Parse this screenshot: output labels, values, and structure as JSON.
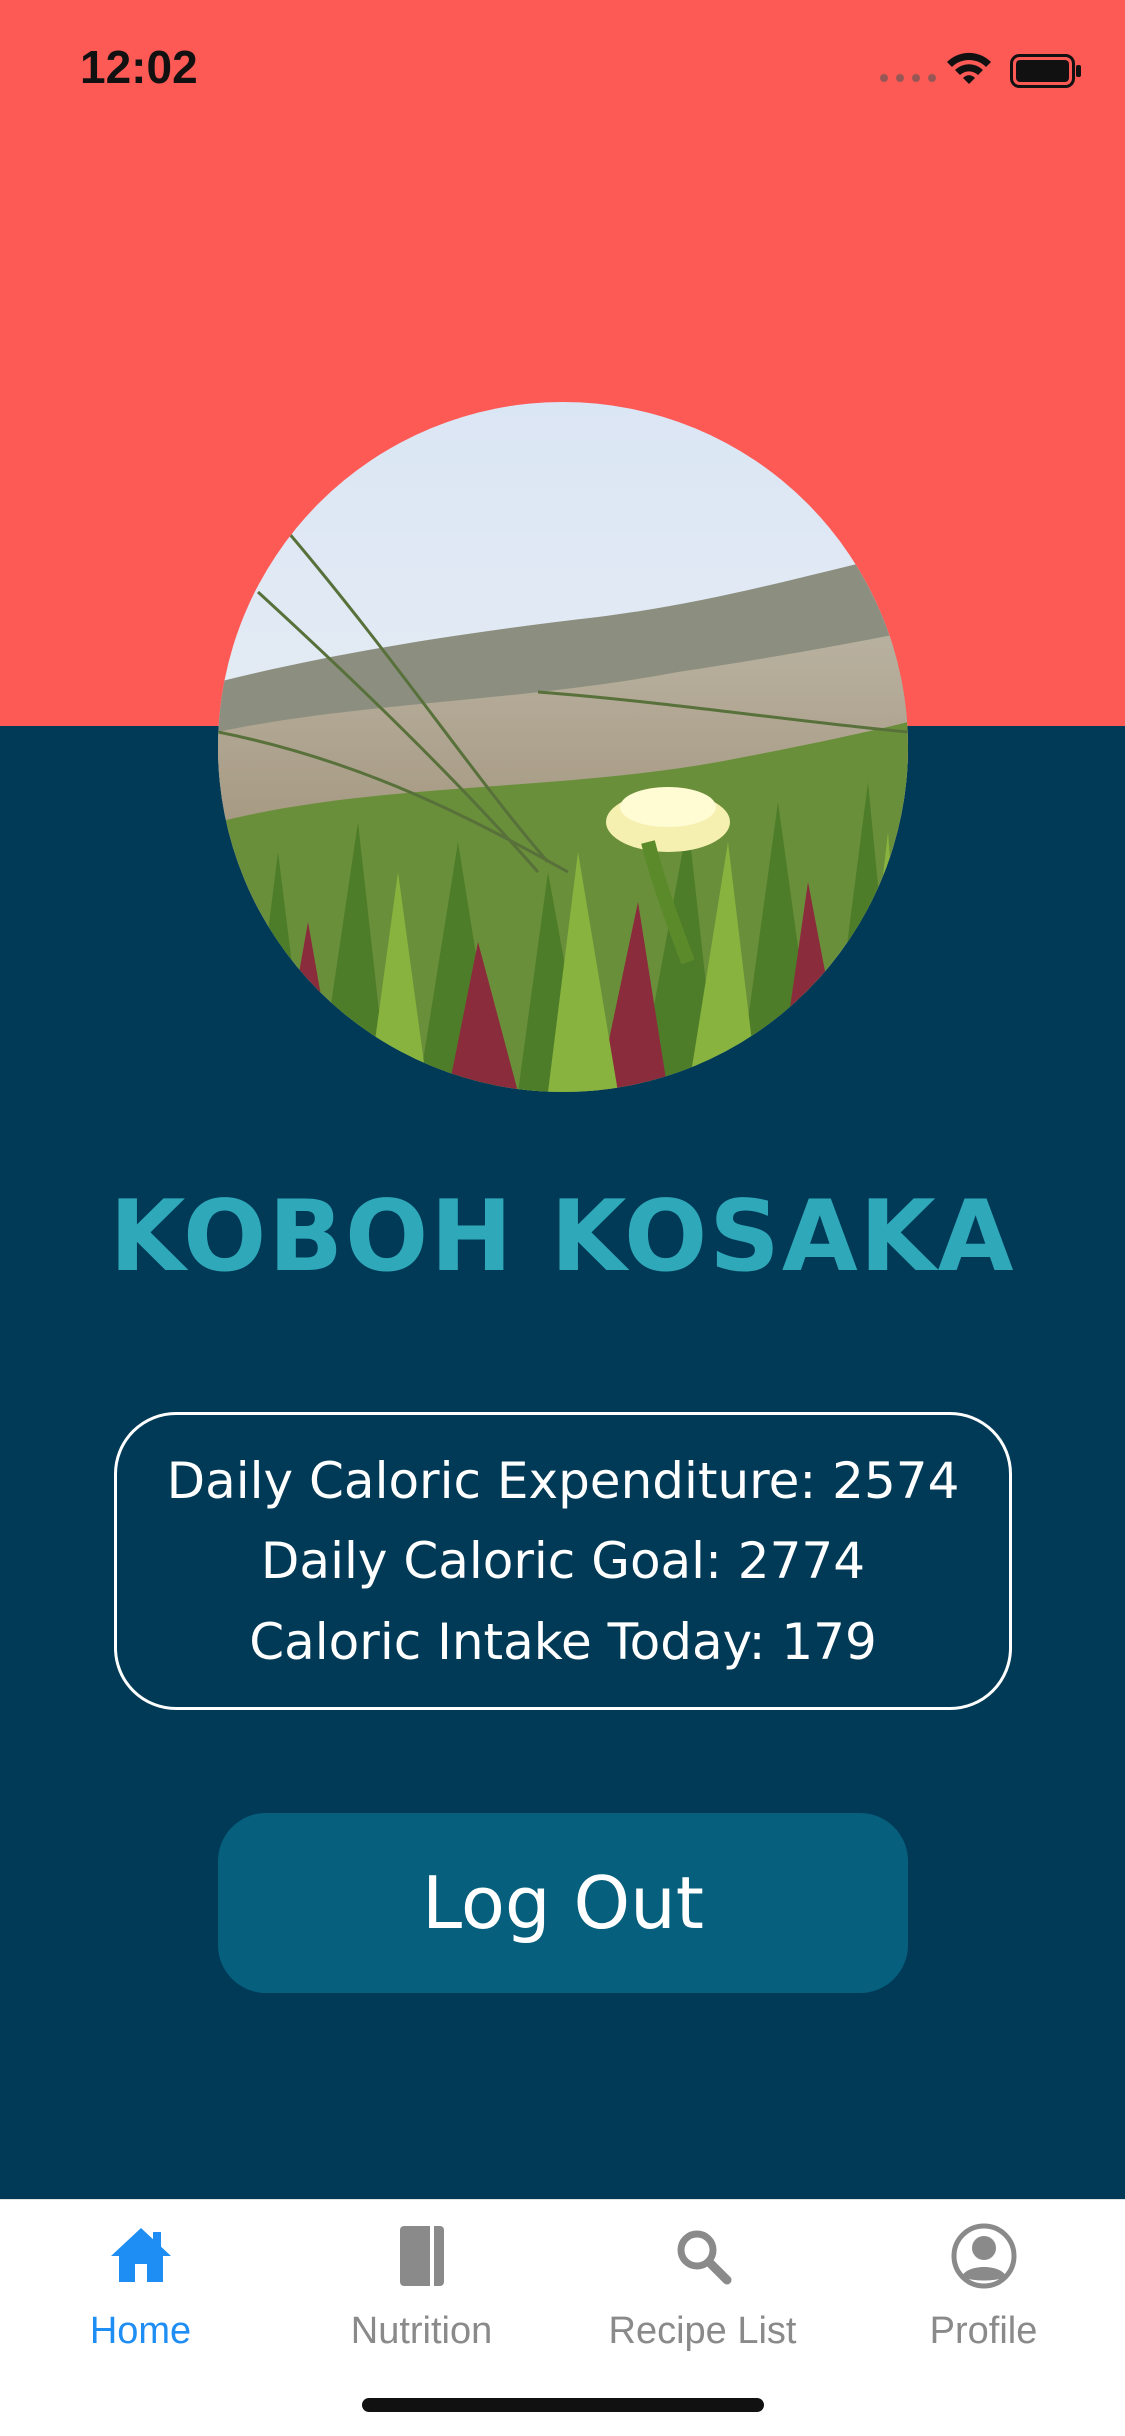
{
  "status_bar": {
    "time": "12:02",
    "icons": [
      "signal-dots-icon",
      "wifi-icon",
      "battery-icon"
    ]
  },
  "colors": {
    "top_band": "#fd5a56",
    "background": "#013a57",
    "name": "#2fa9ba",
    "button": "#065f7d",
    "tab_active": "#1e8ef5",
    "tab_inactive": "#8a8a8a"
  },
  "profile": {
    "name": "KOBOH KOSAKA",
    "avatar_icon": "profile-photo-flower"
  },
  "stats": {
    "expenditure": "Daily Caloric Expenditure: 2574",
    "goal": "Daily Caloric Goal: 2774",
    "intake": "Caloric Intake Today: 179"
  },
  "logout_label": "Log Out",
  "tabs": [
    {
      "label": "Home",
      "icon": "home-icon",
      "active": true
    },
    {
      "label": "Nutrition",
      "icon": "book-icon",
      "active": false
    },
    {
      "label": "Recipe List",
      "icon": "search-icon",
      "active": false
    },
    {
      "label": "Profile",
      "icon": "profile-icon",
      "active": false
    }
  ]
}
